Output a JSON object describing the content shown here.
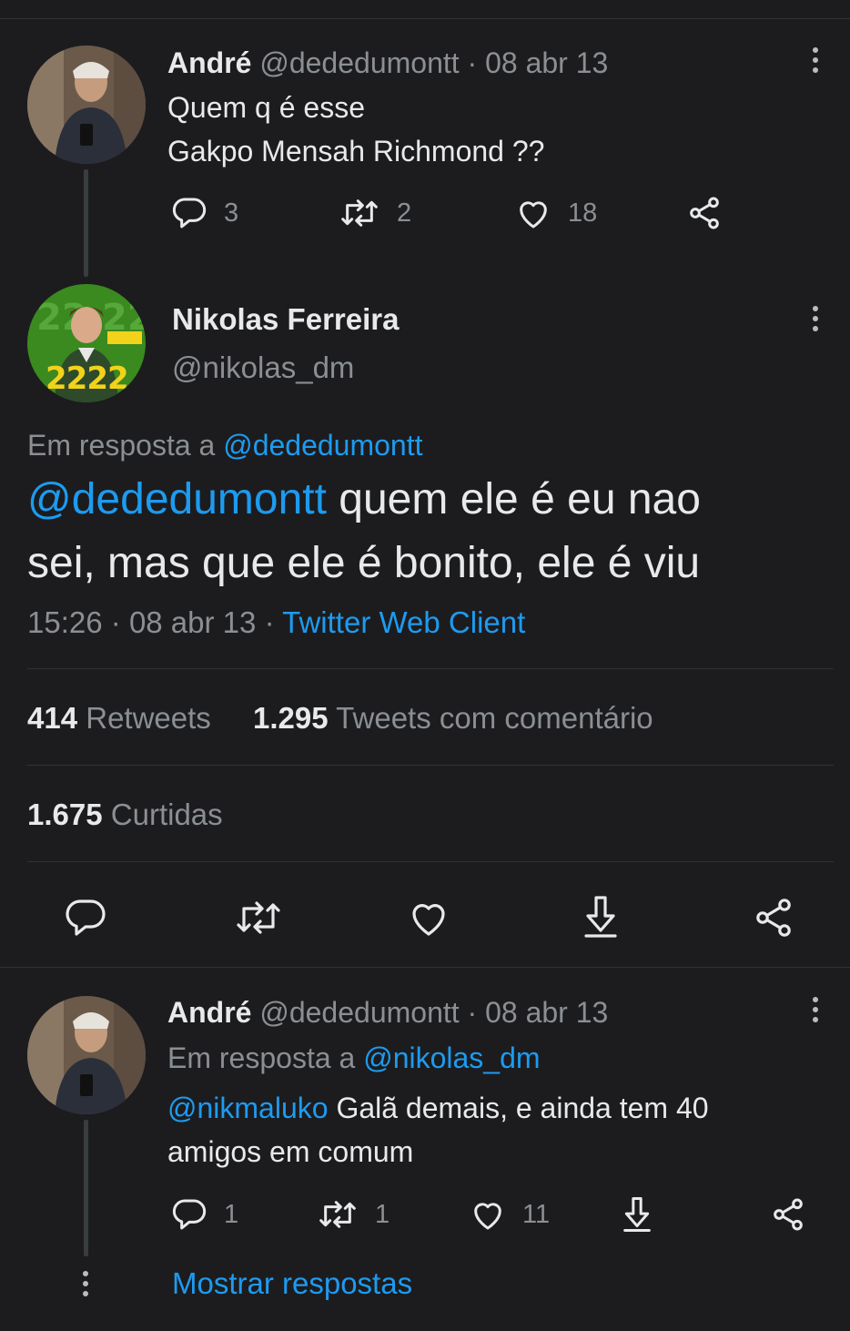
{
  "tweet1": {
    "name": "André",
    "handle": "@dededumontt",
    "separator": "·",
    "date": "08 abr 13",
    "text_line1": "Quem q é esse",
    "text_line2": "Gakpo Mensah Richmond ??",
    "replies": "3",
    "retweets": "2",
    "likes": "18"
  },
  "main_tweet": {
    "name": "Nikolas Ferreira",
    "handle": "@nikolas_dm",
    "avatar_badge": "2222",
    "reply_to_label": "Em resposta a",
    "reply_to_handle": "@dededumontt",
    "mention": "@dededumontt",
    "text_after_mention": " quem ele é eu nao",
    "text_line2": "sei, mas que ele é bonito, ele é viu",
    "time": "15:26",
    "date": "08 abr 13",
    "separator": "·",
    "client": "Twitter Web Client",
    "retweets_count": "1.295",
    "retweets_count_prefix": "414",
    "retweets_label": "Retweets",
    "quote_label": "Tweets com comentário",
    "likes_count": "1.675",
    "likes_label": "Curtidas"
  },
  "tweet3": {
    "name": "André",
    "handle": "@dededumontt",
    "separator": "·",
    "date": "08 abr 13",
    "reply_to_label": "Em resposta a",
    "reply_to_handle": "@nikolas_dm",
    "mention": "@nikmaluko",
    "text_after_mention": " Galã demais, e ainda tem 40",
    "text_line2": "amigos em comum",
    "replies": "1",
    "retweets": "1",
    "likes": "11"
  },
  "show_replies": "Mostrar respostas",
  "colors": {
    "background": "#1c1c1e",
    "accent": "#1d9bf0",
    "muted": "#8b8f94",
    "text": "#e7e9ea",
    "badge_green": "#3a8a1f",
    "badge_yellow": "#f2d21b"
  },
  "icons": [
    "reply-icon",
    "retweet-icon",
    "like-icon",
    "share-icon",
    "download-icon",
    "more-icon"
  ]
}
